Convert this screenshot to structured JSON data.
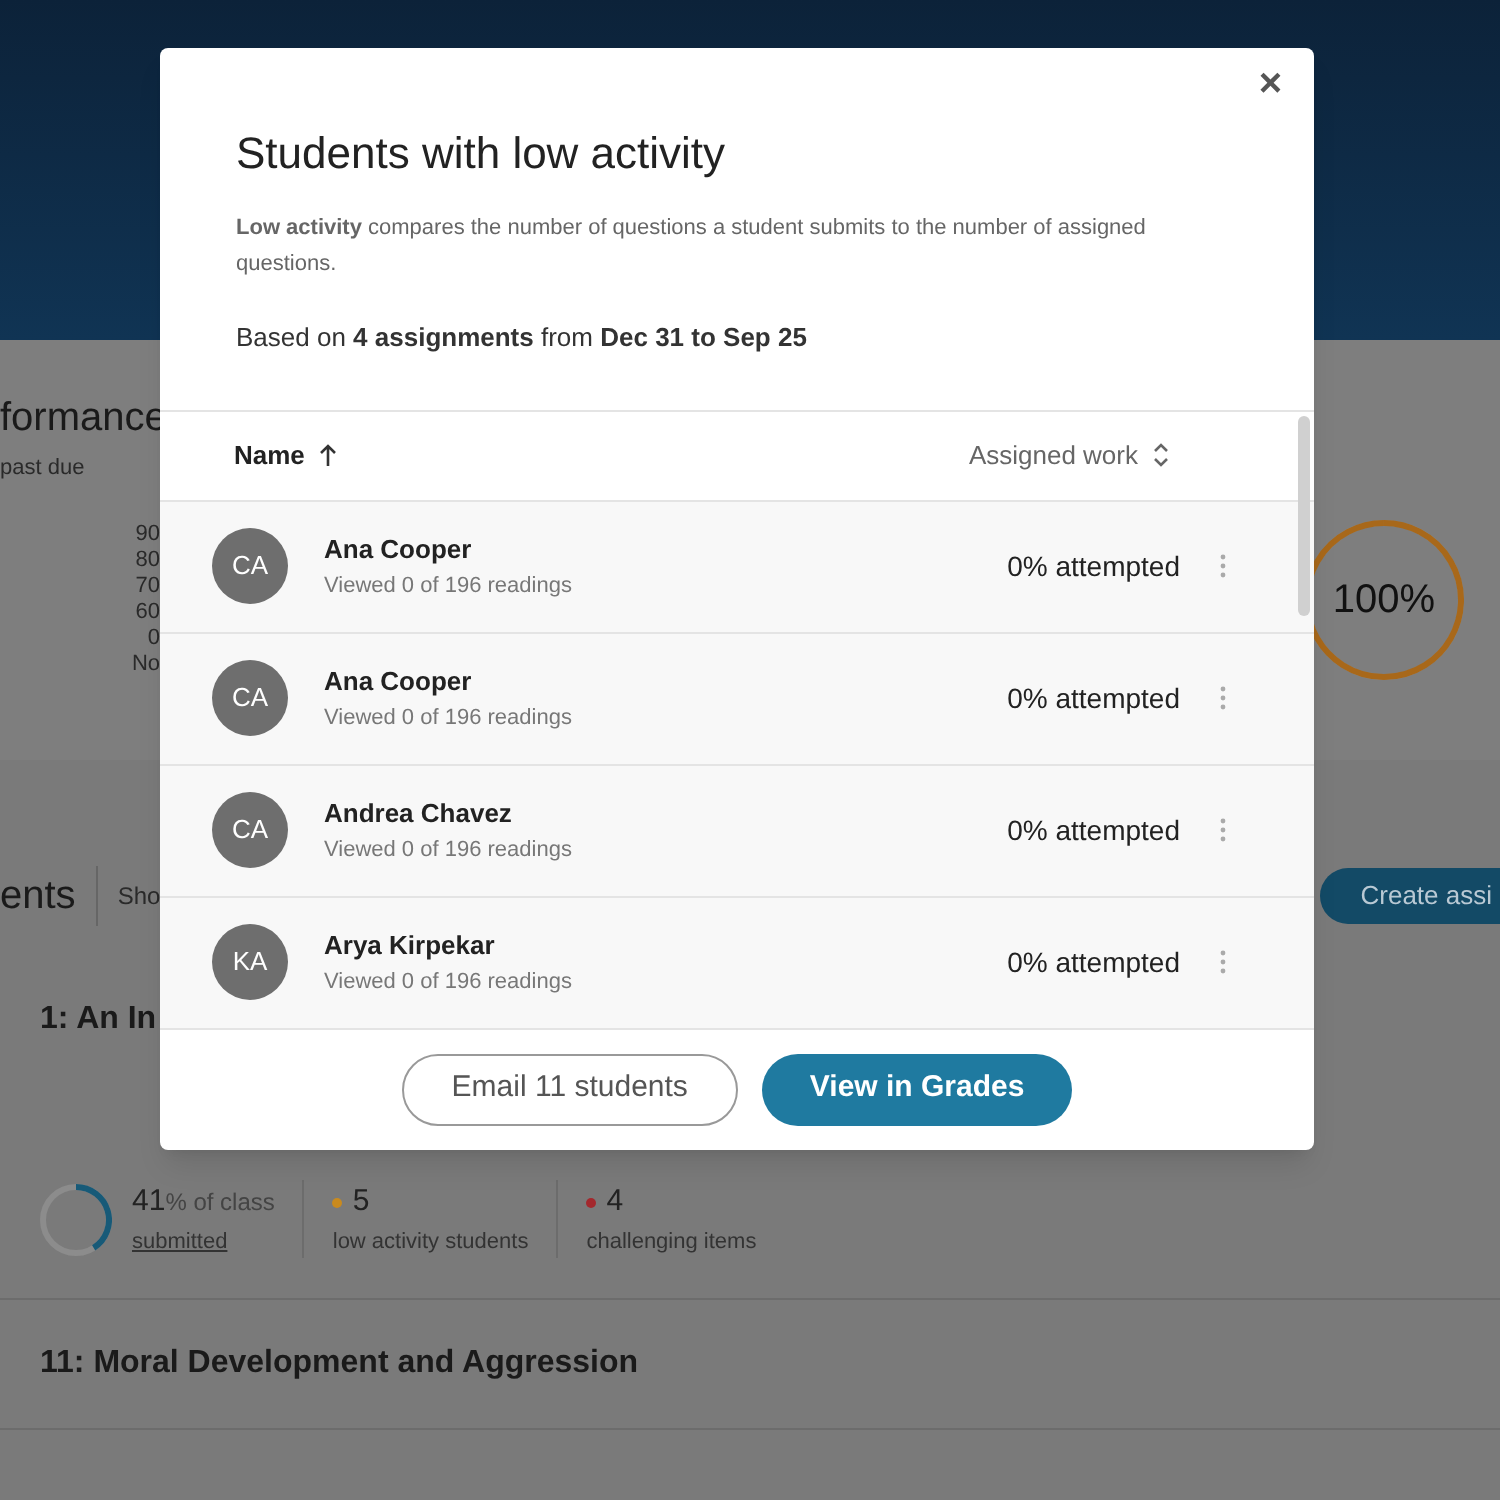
{
  "background": {
    "performance": {
      "title": "formance",
      "subtitle": "past due",
      "axis_labels": [
        "90",
        "80",
        "70",
        "60",
        "0",
        "No"
      ],
      "score": {
        "text": "100%",
        "level": 1.0
      }
    },
    "assignments": {
      "title": "ents",
      "filter": "Sho",
      "create_button": "Create assi",
      "items": [
        {
          "title": "1: An In",
          "submitted": {
            "value": "41",
            "suffix": "% of class",
            "link": "submitted",
            "level": 0.41
          },
          "stats": [
            {
              "value": "5",
              "label": "low activity students",
              "color": "#c98a1e"
            },
            {
              "value": "4",
              "label": "challenging items",
              "color": "#a3282d"
            }
          ]
        },
        {
          "title": "11: Moral Development and Aggression"
        }
      ]
    }
  },
  "modal": {
    "title": "Students with low activity",
    "close": "×",
    "description": "**Low activity** compares the number of questions a student submits to the number of assigned questions.",
    "basis": "Based on **4 assignments** from **Dec 31 to Sep 25**",
    "columns": [
      {
        "label": "Name",
        "sorted": true
      },
      {
        "label": "Assigned work",
        "sorted": false
      }
    ],
    "rows": [
      {
        "initials": "CA",
        "name": "Ana Cooper",
        "detail": "Viewed 0 of 196 readings",
        "status": "0% attempted"
      },
      {
        "initials": "CA",
        "name": "Ana Cooper",
        "detail": "Viewed 0 of 196 readings",
        "status": "0% attempted"
      },
      {
        "initials": "CA",
        "name": "Andrea Chavez",
        "detail": "Viewed 0 of 196 readings",
        "status": "0% attempted"
      },
      {
        "initials": "KA",
        "name": "Arya Kirpekar",
        "detail": "Viewed 0 of 196 readings",
        "status": "0% attempted"
      }
    ],
    "buttons": [
      {
        "label": "Email 11 students",
        "kind": "secondary"
      },
      {
        "label": "View in Grades",
        "kind": "primary"
      }
    ]
  }
}
